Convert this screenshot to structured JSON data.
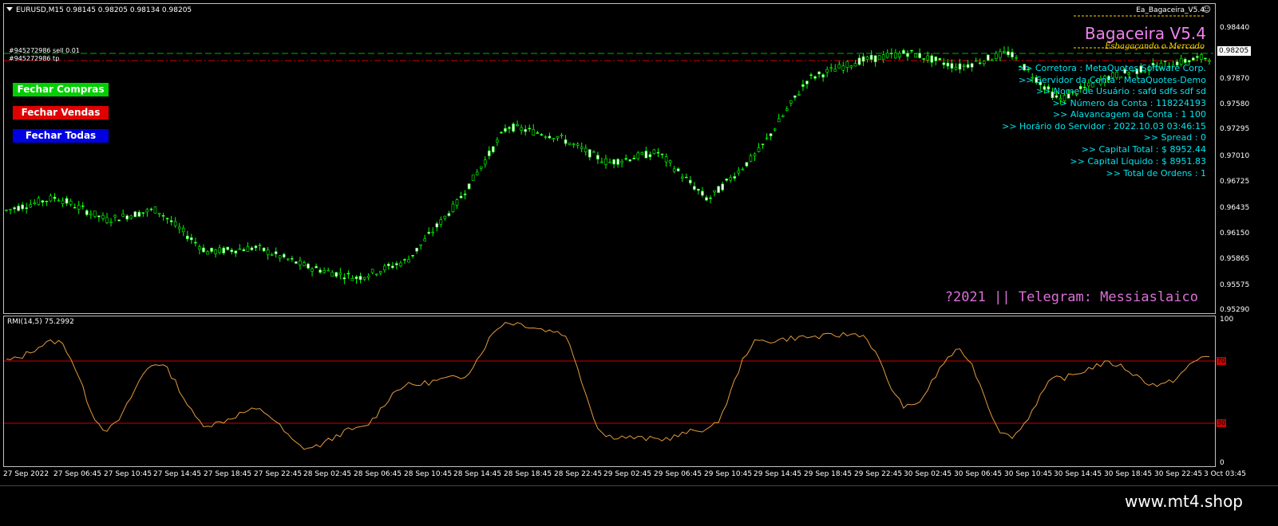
{
  "chart_header": {
    "symbol_text": "EURUSD,M15  0.98145 0.98205 0.98134 0.98205",
    "ea_label": "Ea_Bagaceira_V5.4",
    "smile_glyph": "☺"
  },
  "orders": {
    "sell_label": "#945272986 sell 0.01",
    "tp_label": "#945272986 tp"
  },
  "buttons": {
    "close_buys": "Fechar Compras",
    "close_sells": "Fechar Vendas",
    "close_all": "Fechar Todas"
  },
  "ea_panel": {
    "title": "Bagaceira V5.4",
    "subtitle": "Esbagaçando o Mercado",
    "lines": [
      ">> Corretora : MetaQuotes Software Corp.",
      ">> Servidor da Conta  : MetaQuotes-Demo",
      ">> Nome de Usuário  : safd   sdfs sdf  sd",
      ">> Número da Conta  : 118224193",
      ">> Alavancagem da Conta  : 1 100",
      ">> Horário do Servidor  : 2022.10.03 03:46:15",
      ">> Spread  : 0",
      ">> Capital Total  : $ 8952.44",
      ">> Capital Líquido  : $ 8951.83",
      ">> Total de Ordens  : 1"
    ],
    "telegram": "?2021 || Telegram: Messiaslaico"
  },
  "price_axis": {
    "ticks": [
      "0.98440",
      "0.97870",
      "0.97580",
      "0.97295",
      "0.97010",
      "0.96725",
      "0.96435",
      "0.96150",
      "0.95865",
      "0.95575",
      "0.95290"
    ],
    "current_price": "0.98205"
  },
  "rmi": {
    "label": "RMI(14,5) 75.2992",
    "ticks": [
      "100",
      "0"
    ],
    "levels": [
      "70",
      "30"
    ]
  },
  "time_axis": {
    "labels": [
      "27 Sep 2022",
      "27 Sep 06:45",
      "27 Sep 10:45",
      "27 Sep 14:45",
      "27 Sep 18:45",
      "27 Sep 22:45",
      "28 Sep 02:45",
      "28 Sep 06:45",
      "28 Sep 10:45",
      "28 Sep 14:45",
      "28 Sep 18:45",
      "28 Sep 22:45",
      "29 Sep 02:45",
      "29 Sep 06:45",
      "29 Sep 10:45",
      "29 Sep 14:45",
      "29 Sep 18:45",
      "29 Sep 22:45",
      "30 Sep 02:45",
      "30 Sep 06:45",
      "30 Sep 10:45",
      "30 Sep 14:45",
      "30 Sep 18:45",
      "30 Sep 22:45",
      "3 Oct 03:45"
    ]
  },
  "footer": {
    "watermark": "www.mt4.shop"
  },
  "chart_data": [
    {
      "type": "line",
      "name": "EURUSD M15 price",
      "ylim": [
        0.9529,
        0.9858
      ],
      "x": [
        0,
        1,
        2,
        3,
        4,
        5,
        6,
        7,
        8,
        9,
        10,
        11,
        12,
        13,
        14,
        15,
        16,
        17,
        18,
        19,
        20,
        21,
        22,
        23,
        24
      ],
      "series": [
        {
          "values": [
            0.9643,
            0.9658,
            0.9632,
            0.9644,
            0.9595,
            0.96,
            0.9578,
            0.9565,
            0.9585,
            0.9652,
            0.974,
            0.9728,
            0.9698,
            0.971,
            0.9655,
            0.971,
            0.9795,
            0.9815,
            0.9825,
            0.9808,
            0.9825,
            0.977,
            0.9797,
            0.981,
            0.982
          ]
        }
      ]
    },
    {
      "type": "line",
      "name": "RMI(14,5)",
      "ylim": [
        0,
        100
      ],
      "x": [
        0,
        1,
        2,
        3,
        4,
        5,
        6,
        7,
        8,
        9,
        10,
        11,
        12,
        13,
        14,
        15,
        16,
        17,
        18,
        19,
        20,
        21,
        22,
        23,
        24
      ],
      "series": [
        {
          "values": [
            72,
            85,
            25,
            70,
            28,
            38,
            12,
            25,
            55,
            60,
            98,
            92,
            20,
            18,
            25,
            85,
            88,
            90,
            40,
            78,
            20,
            60,
            70,
            55,
            75
          ]
        }
      ]
    }
  ]
}
